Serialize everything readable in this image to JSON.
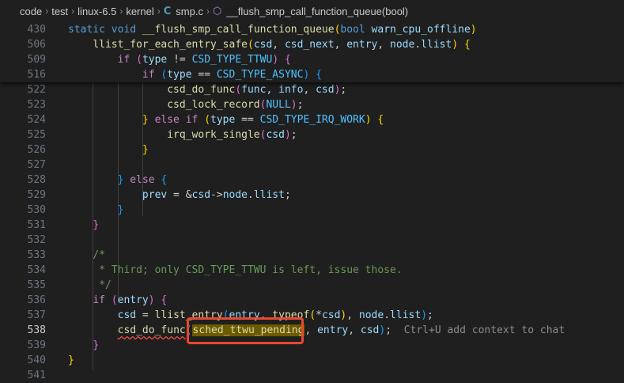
{
  "breadcrumb": {
    "items": [
      "code",
      "test",
      "linux-6.5",
      "kernel",
      "smp.c",
      "__flush_smp_call_function_queue(bool)"
    ],
    "file_icon": "C",
    "symbol_icon": "cube-icon"
  },
  "sticky": [
    {
      "ln": "430",
      "code": "static void __flush_smp_call_function_queue(bool warn_cpu_offline)"
    },
    {
      "ln": "506",
      "code": "    llist_for_each_entry_safe(csd, csd_next, entry, node.llist) {"
    },
    {
      "ln": "509",
      "code": "        if (type != CSD_TYPE_TTWU) {"
    },
    {
      "ln": "516",
      "code": "            if (type == CSD_TYPE_ASYNC) {"
    }
  ],
  "lines": [
    {
      "ln": "522",
      "code": "                csd_do_func(func, info, csd);"
    },
    {
      "ln": "523",
      "code": "                csd_lock_record(NULL);"
    },
    {
      "ln": "524",
      "code": "            } else if (type == CSD_TYPE_IRQ_WORK) {"
    },
    {
      "ln": "525",
      "code": "                irq_work_single(csd);"
    },
    {
      "ln": "526",
      "code": "            }"
    },
    {
      "ln": "527",
      "code": ""
    },
    {
      "ln": "528",
      "code": "        } else {"
    },
    {
      "ln": "529",
      "code": "            prev = &csd->node.llist;"
    },
    {
      "ln": "530",
      "code": "        }"
    },
    {
      "ln": "531",
      "code": "    }"
    },
    {
      "ln": "532",
      "code": ""
    },
    {
      "ln": "533",
      "code": "    /*"
    },
    {
      "ln": "534",
      "code": "     * Third; only CSD_TYPE_TTWU is left, issue those."
    },
    {
      "ln": "535",
      "code": "     */"
    },
    {
      "ln": "536",
      "code": "    if (entry) {"
    },
    {
      "ln": "537",
      "code": "        csd = llist_entry(entry, typeof(*csd), node.llist);"
    },
    {
      "ln": "538",
      "code": "        csd_do_func(sched_ttwu_pending, entry, csd);"
    },
    {
      "ln": "539",
      "code": "    }"
    },
    {
      "ln": "540",
      "code": "}"
    },
    {
      "ln": "541",
      "code": ""
    }
  ],
  "ghost_hint": "Ctrl+U add context to chat",
  "highlighted_word": "sched_ttwu_pending",
  "active_line": "538"
}
